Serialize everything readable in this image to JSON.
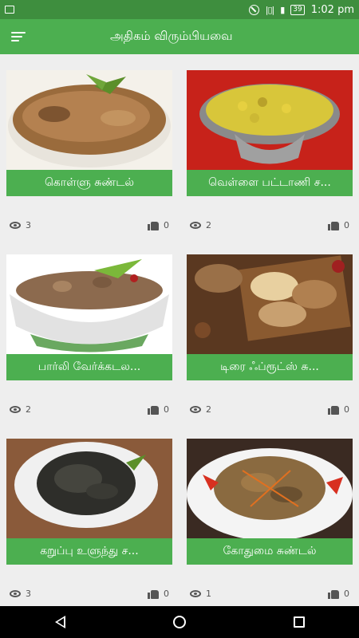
{
  "status_bar": {
    "time": "1:02 pm",
    "battery": "39"
  },
  "app_bar": {
    "title": "அதிகம் விரும்பியவை"
  },
  "recipes": [
    {
      "title": "கொள்ளு சுண்டல்",
      "views": "3",
      "likes": "0"
    },
    {
      "title": "வெள்ளை பட்டாணி ச...",
      "views": "2",
      "likes": "0"
    },
    {
      "title": "பார்லி வேர்க்கடல...",
      "views": "2",
      "likes": "0"
    },
    {
      "title": "டிரை ஃப்ரூட்ஸ் சு...",
      "views": "2",
      "likes": "0"
    },
    {
      "title": "கறுப்பு உளுந்து ச...",
      "views": "3",
      "likes": "0"
    },
    {
      "title": "கோதுமை சுண்டல்",
      "views": "1",
      "likes": "0"
    }
  ],
  "colors": {
    "primary": "#4caf50",
    "status": "#3e8e3e",
    "background": "#eeeeee"
  }
}
